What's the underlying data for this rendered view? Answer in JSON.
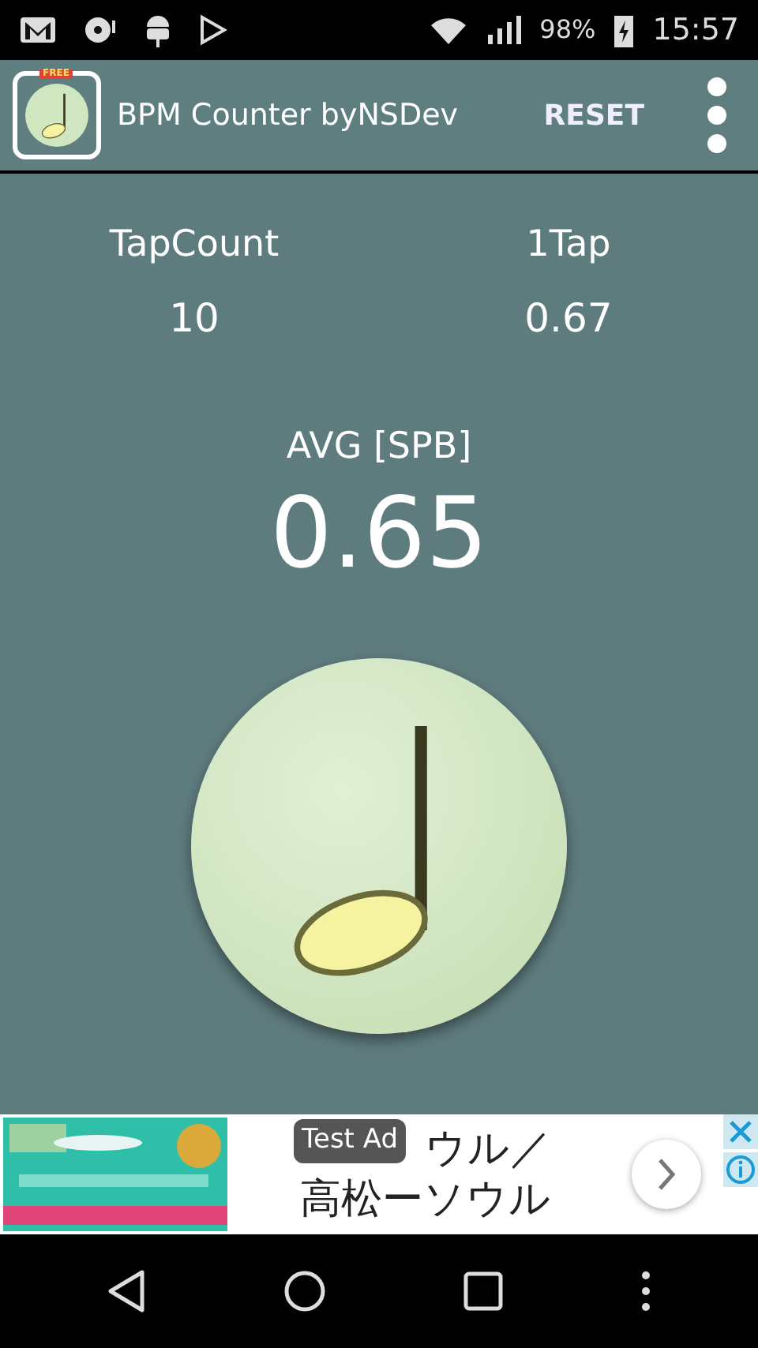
{
  "status_bar": {
    "battery": "98%",
    "time": "15:57"
  },
  "app_bar": {
    "badge": "FREE",
    "title": "BPM Counter byNSDev",
    "action": "RESET"
  },
  "stats": [
    {
      "label": "TapCount",
      "value": "10"
    },
    {
      "label": "1Tap",
      "value": "0.67"
    }
  ],
  "average": {
    "label": "AVG [SPB]",
    "value": "0.65"
  },
  "ad": {
    "badge": "Test Ad",
    "headline_lines": [
      "ウル／",
      "高松ーソウル"
    ]
  }
}
